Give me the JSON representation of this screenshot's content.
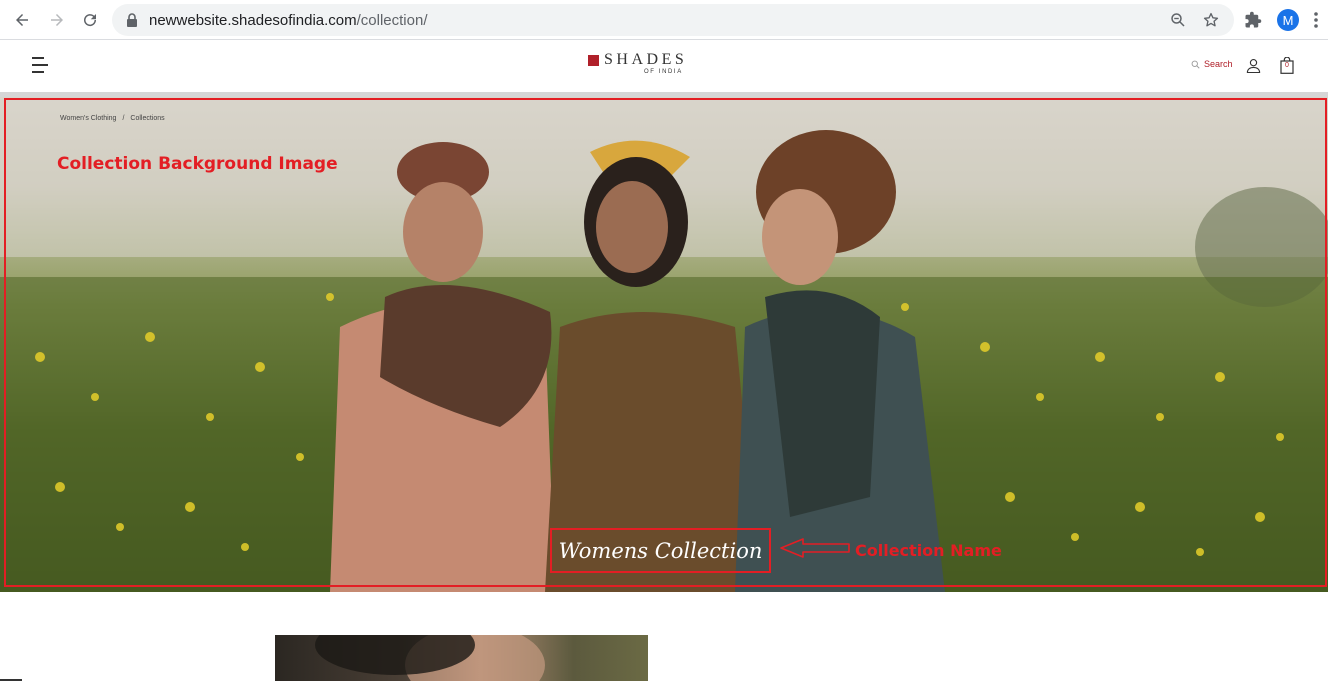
{
  "browser": {
    "url_host": "newwebsite.shadesofindia.com",
    "url_path": "/collection/",
    "profile_initial": "M",
    "icons": [
      "back-arrow-icon",
      "forward-arrow-icon",
      "reload-icon",
      "lock-icon",
      "zoom-icon",
      "star-icon",
      "extensions-icon",
      "more-menu-icon"
    ]
  },
  "site": {
    "logo_main": "SHADES",
    "logo_sub": "OF INDIA",
    "search_label": "Search",
    "cart_count": "0",
    "brand_color": "#b0202a"
  },
  "breadcrumb": {
    "items": [
      "Women's Clothing",
      "Collections"
    ],
    "separator": "/"
  },
  "hero": {
    "collection_name": "Womens Collection"
  },
  "annotations": {
    "background_label": "Collection Background Image",
    "name_label": "Collection Name",
    "color": "#e31e24"
  }
}
